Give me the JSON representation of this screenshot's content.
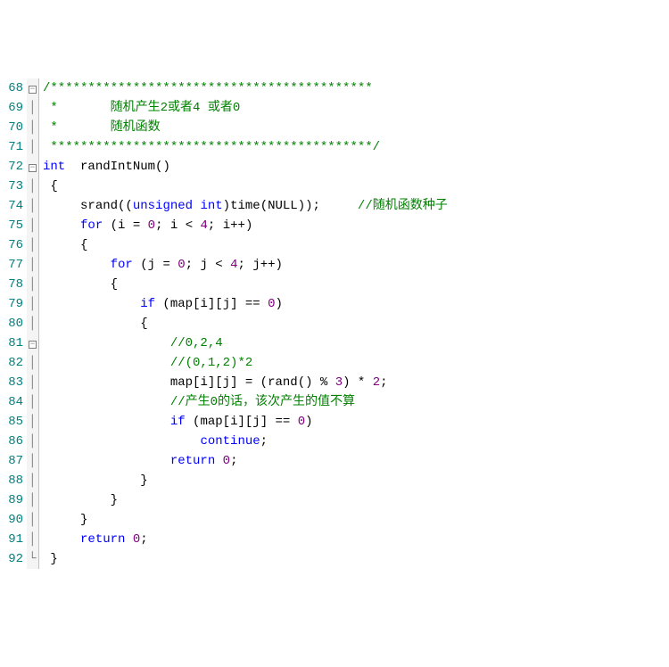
{
  "lines": [
    {
      "num": "68",
      "fold": "minus",
      "tokens": [
        [
          "cm",
          "/*******************************************"
        ]
      ]
    },
    {
      "num": "69",
      "fold": "pipe",
      "tokens": [
        [
          "cm",
          " *       随机产生2或者4 或者0"
        ]
      ]
    },
    {
      "num": "70",
      "fold": "pipe",
      "tokens": [
        [
          "cm",
          " *       随机函数"
        ]
      ]
    },
    {
      "num": "71",
      "fold": "pipe",
      "tokens": [
        [
          "cm",
          " *******************************************/"
        ]
      ]
    },
    {
      "num": "72",
      "fold": "minus",
      "tokens": [
        [
          "tp",
          "int"
        ],
        [
          "op",
          "  "
        ],
        [
          "id",
          "randIntNum"
        ],
        [
          "op",
          "()"
        ]
      ]
    },
    {
      "num": "73",
      "fold": "pipe",
      "tokens": [
        [
          "op",
          " {"
        ]
      ]
    },
    {
      "num": "74",
      "fold": "pipe",
      "tokens": [
        [
          "op",
          "     "
        ],
        [
          "id",
          "srand"
        ],
        [
          "op",
          "(("
        ],
        [
          "tp",
          "unsigned int"
        ],
        [
          "op",
          ")"
        ],
        [
          "id",
          "time"
        ],
        [
          "op",
          "("
        ],
        [
          "id",
          "NULL"
        ],
        [
          "op",
          "));     "
        ],
        [
          "cm",
          "//随机函数种子"
        ]
      ]
    },
    {
      "num": "75",
      "fold": "pipe",
      "tokens": [
        [
          "op",
          "     "
        ],
        [
          "kw",
          "for"
        ],
        [
          "op",
          " ("
        ],
        [
          "id",
          "i"
        ],
        [
          "op",
          " = "
        ],
        [
          "num",
          "0"
        ],
        [
          "op",
          "; "
        ],
        [
          "id",
          "i"
        ],
        [
          "op",
          " < "
        ],
        [
          "num",
          "4"
        ],
        [
          "op",
          "; "
        ],
        [
          "id",
          "i"
        ],
        [
          "op",
          "++)"
        ]
      ]
    },
    {
      "num": "76",
      "fold": "pipe",
      "tokens": [
        [
          "op",
          "     {"
        ]
      ]
    },
    {
      "num": "77",
      "fold": "pipe",
      "tokens": [
        [
          "op",
          "         "
        ],
        [
          "kw",
          "for"
        ],
        [
          "op",
          " ("
        ],
        [
          "id",
          "j"
        ],
        [
          "op",
          " = "
        ],
        [
          "num",
          "0"
        ],
        [
          "op",
          "; "
        ],
        [
          "id",
          "j"
        ],
        [
          "op",
          " < "
        ],
        [
          "num",
          "4"
        ],
        [
          "op",
          "; "
        ],
        [
          "id",
          "j"
        ],
        [
          "op",
          "++)"
        ]
      ]
    },
    {
      "num": "78",
      "fold": "pipe",
      "tokens": [
        [
          "op",
          "         {"
        ]
      ]
    },
    {
      "num": "79",
      "fold": "pipe",
      "tokens": [
        [
          "op",
          "             "
        ],
        [
          "kw",
          "if"
        ],
        [
          "op",
          " ("
        ],
        [
          "id",
          "map"
        ],
        [
          "op",
          "["
        ],
        [
          "id",
          "i"
        ],
        [
          "op",
          "]["
        ],
        [
          "id",
          "j"
        ],
        [
          "op",
          "] == "
        ],
        [
          "num",
          "0"
        ],
        [
          "op",
          ")"
        ]
      ]
    },
    {
      "num": "80",
      "fold": "pipe",
      "tokens": [
        [
          "op",
          "             {"
        ]
      ]
    },
    {
      "num": "81",
      "fold": "minus",
      "tokens": [
        [
          "op",
          "                 "
        ],
        [
          "cm",
          "//0,2,4"
        ]
      ]
    },
    {
      "num": "82",
      "fold": "pipe",
      "tokens": [
        [
          "op",
          "                 "
        ],
        [
          "cm",
          "//(0,1,2)*2"
        ]
      ]
    },
    {
      "num": "83",
      "fold": "pipe",
      "tokens": [
        [
          "op",
          "                 "
        ],
        [
          "id",
          "map"
        ],
        [
          "op",
          "["
        ],
        [
          "id",
          "i"
        ],
        [
          "op",
          "]["
        ],
        [
          "id",
          "j"
        ],
        [
          "op",
          "] = ("
        ],
        [
          "id",
          "rand"
        ],
        [
          "op",
          "() % "
        ],
        [
          "num",
          "3"
        ],
        [
          "op",
          ") * "
        ],
        [
          "num",
          "2"
        ],
        [
          "op",
          ";"
        ]
      ]
    },
    {
      "num": "84",
      "fold": "pipe",
      "tokens": [
        [
          "op",
          "                 "
        ],
        [
          "cm",
          "//产生0的话，该次产生的值不算"
        ]
      ]
    },
    {
      "num": "85",
      "fold": "pipe",
      "tokens": [
        [
          "op",
          "                 "
        ],
        [
          "kw",
          "if"
        ],
        [
          "op",
          " ("
        ],
        [
          "id",
          "map"
        ],
        [
          "op",
          "["
        ],
        [
          "id",
          "i"
        ],
        [
          "op",
          "]["
        ],
        [
          "id",
          "j"
        ],
        [
          "op",
          "] == "
        ],
        [
          "num",
          "0"
        ],
        [
          "op",
          ")"
        ]
      ]
    },
    {
      "num": "86",
      "fold": "pipe",
      "tokens": [
        [
          "op",
          "                     "
        ],
        [
          "kw",
          "continue"
        ],
        [
          "op",
          ";"
        ]
      ]
    },
    {
      "num": "87",
      "fold": "pipe",
      "tokens": [
        [
          "op",
          "                 "
        ],
        [
          "kw",
          "return"
        ],
        [
          "op",
          " "
        ],
        [
          "num",
          "0"
        ],
        [
          "op",
          ";"
        ]
      ]
    },
    {
      "num": "88",
      "fold": "pipe",
      "tokens": [
        [
          "op",
          "             }"
        ]
      ]
    },
    {
      "num": "89",
      "fold": "pipe",
      "tokens": [
        [
          "op",
          "         }"
        ]
      ]
    },
    {
      "num": "90",
      "fold": "pipe",
      "tokens": [
        [
          "op",
          "     }"
        ]
      ]
    },
    {
      "num": "91",
      "fold": "pipe",
      "tokens": [
        [
          "op",
          "     "
        ],
        [
          "kw",
          "return"
        ],
        [
          "op",
          " "
        ],
        [
          "num",
          "0"
        ],
        [
          "op",
          ";"
        ]
      ]
    },
    {
      "num": "92",
      "fold": "end",
      "tokens": [
        [
          "op",
          " }"
        ]
      ]
    }
  ]
}
